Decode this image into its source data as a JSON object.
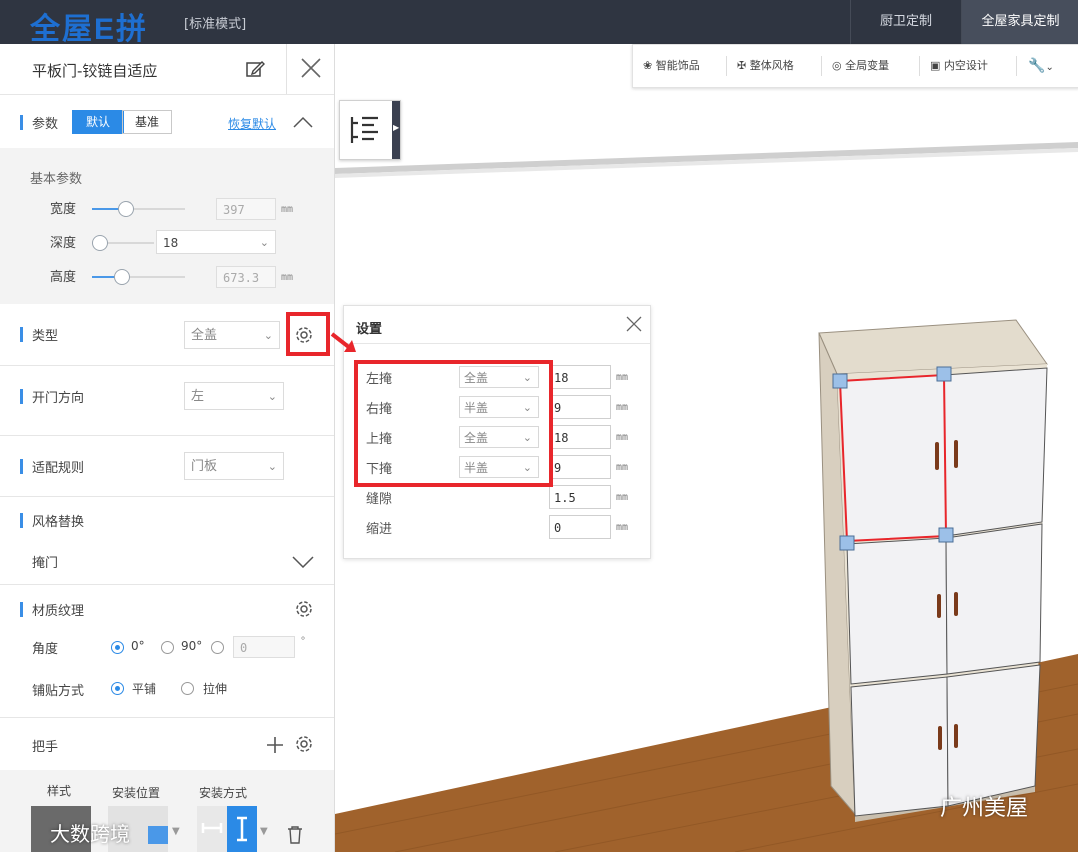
{
  "topbar": {
    "logo": "全屋E拼",
    "mode": "[标准模式]",
    "tabs": [
      {
        "label": "厨卫定制",
        "active": false
      },
      {
        "label": "全屋家具定制",
        "active": true
      }
    ]
  },
  "panel": {
    "title": "平板门-铰链自适应",
    "params": {
      "label": "参数",
      "seg_default": "默认",
      "seg_base": "基准",
      "restore": "恢复默认"
    },
    "basic": {
      "heading": "基本参数",
      "width_label": "宽度",
      "width_value": "397",
      "width_unit": "mm",
      "depth_label": "深度",
      "depth_value": "18",
      "height_label": "高度",
      "height_value": "673.3",
      "height_unit": "mm"
    },
    "type": {
      "label": "类型",
      "value": "全盖"
    },
    "door_dir": {
      "label": "开门方向",
      "value": "左"
    },
    "fit_rule": {
      "label": "适配规则",
      "value": "门板"
    },
    "style_swap": {
      "label": "风格替换",
      "item": "掩门"
    },
    "material": {
      "label": "材质纹理",
      "angle_label": "角度",
      "angle_0": "0°",
      "angle_90": "90°",
      "angle_custom": "0",
      "angle_unit": "°",
      "tile_label": "铺贴方式",
      "tile_flat": "平铺",
      "tile_stretch": "拉伸"
    },
    "handle": {
      "label": "把手",
      "col_style": "样式",
      "col_pos": "安装位置",
      "col_mount": "安装方式"
    }
  },
  "toolbar": {
    "items": [
      {
        "label": "智能饰品",
        "icon": "plant-icon"
      },
      {
        "label": "整体风格",
        "icon": "fan-icon"
      },
      {
        "label": "全局变量",
        "icon": "globe-grid-icon"
      },
      {
        "label": "内空设计",
        "icon": "frame-icon"
      }
    ],
    "tools_icon": "wrench-icon"
  },
  "dialog": {
    "title": "设置",
    "rows": [
      {
        "label": "左掩",
        "select": "全盖",
        "value": "18",
        "unit": "mm"
      },
      {
        "label": "右掩",
        "select": "半盖",
        "value": "9",
        "unit": "mm"
      },
      {
        "label": "上掩",
        "select": "全盖",
        "value": "18",
        "unit": "mm"
      },
      {
        "label": "下掩",
        "select": "半盖",
        "value": "9",
        "unit": "mm"
      },
      {
        "label": "缝隙",
        "select": null,
        "value": "1.5",
        "unit": "mm"
      },
      {
        "label": "缩进",
        "select": null,
        "value": "0",
        "unit": "mm"
      }
    ]
  },
  "watermarks": {
    "left": "大数跨境",
    "right": "广州美屋"
  },
  "colors": {
    "accent": "#2b8ae6",
    "topbar": "#2f3541",
    "highlight": "#e8262b",
    "floor": "#a0622c"
  }
}
